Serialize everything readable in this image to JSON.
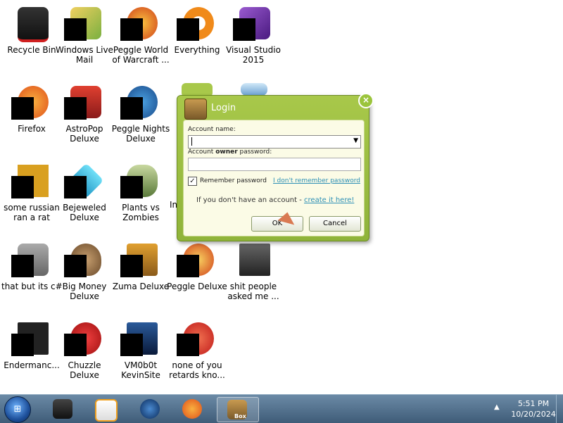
{
  "desktop": {
    "icons": [
      {
        "label": "Recycle Bin",
        "color": "#222222"
      },
      {
        "label": "Windows Live Mail",
        "color": "#e8c04a"
      },
      {
        "label": "Peggle World of Warcraft ...",
        "color": "#e05a1a"
      },
      {
        "label": "Everything",
        "color": "#f08a1a"
      },
      {
        "label": "Visual Studio 2015",
        "color": "#6a3aa0"
      },
      {
        "label": "Firefox",
        "color": "#f07a1a"
      },
      {
        "label": "AstroPop Deluxe",
        "color": "#c0302a"
      },
      {
        "label": "Peggle Nights Deluxe",
        "color": "#2a6ab0"
      },
      {
        "label": "some russian ran a rat",
        "color": "#d9a020"
      },
      {
        "label": "Bejeweled Deluxe",
        "color": "#30c0e0"
      },
      {
        "label": "Plants vs Zombies",
        "color": "#6a8a3a"
      },
      {
        "label": "In",
        "color": "#ffffff"
      },
      {
        "label": "that but its c#",
        "color": "#888888"
      },
      {
        "label": "Big Money Deluxe",
        "color": "#8a6a3a"
      },
      {
        "label": "Zuma Deluxe",
        "color": "#c08a2a"
      },
      {
        "label": "Peggle Deluxe",
        "color": "#d04a2a"
      },
      {
        "label": "shit people asked me ...",
        "color": "#333333"
      },
      {
        "label": "Endermanc...",
        "color": "#222222"
      },
      {
        "label": "Chuzzle Deluxe",
        "color": "#c02020"
      },
      {
        "label": "VM0b0t KevinSite",
        "color": "#1a3a6a"
      },
      {
        "label": "none of you retards kno...",
        "color": "#e03a1a"
      }
    ]
  },
  "dialog": {
    "title": "Login",
    "close_label": "×",
    "account_name_label": "Account name:",
    "password_label_pre": "Account ",
    "password_label_bold": "owner",
    "password_label_post": " password:",
    "account_name_value": "",
    "password_value": "",
    "remember_label": "Remember password",
    "remember_checked_glyph": "✓",
    "forgot_link": "I don't remember password",
    "no_account_text": "If you don't have an account - ",
    "create_link": "create it here!",
    "ok_label": "OK",
    "cancel_label": "Cancel"
  },
  "taskbar": {
    "start_glyph": "⊞",
    "items": [
      {
        "name": "tablet-app",
        "color": "#222222"
      },
      {
        "name": "media-player",
        "color": "#f0a020"
      },
      {
        "name": "globe-app",
        "color": "#1a4a8a"
      },
      {
        "name": "firefox",
        "color": "#f07a1a"
      },
      {
        "name": "login-app",
        "color": "#8fb33a",
        "label": "Box"
      }
    ],
    "tray_arrow": "▲",
    "time": "5:51 PM",
    "date": "10/20/2024"
  }
}
